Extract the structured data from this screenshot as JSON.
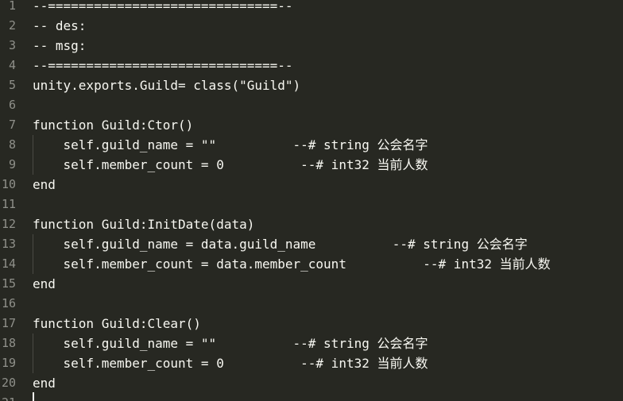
{
  "editor": {
    "lines": [
      {
        "num": "1",
        "text": "--==============================--",
        "indent": 0
      },
      {
        "num": "2",
        "text": "-- des:",
        "indent": 0
      },
      {
        "num": "3",
        "text": "-- msg:",
        "indent": 0
      },
      {
        "num": "4",
        "text": "--==============================--",
        "indent": 0
      },
      {
        "num": "5",
        "text": "unity.exports.Guild= class(\"Guild\")",
        "indent": 0
      },
      {
        "num": "6",
        "text": "",
        "indent": 0
      },
      {
        "num": "7",
        "text": "function Guild:Ctor()",
        "indent": 0
      },
      {
        "num": "8",
        "text": "    self.guild_name = \"\"          --# string 公会名字",
        "indent": 1
      },
      {
        "num": "9",
        "text": "    self.member_count = 0          --# int32 当前人数",
        "indent": 1
      },
      {
        "num": "10",
        "text": "end",
        "indent": 0
      },
      {
        "num": "11",
        "text": "",
        "indent": 0
      },
      {
        "num": "12",
        "text": "function Guild:InitDate(data)",
        "indent": 0
      },
      {
        "num": "13",
        "text": "    self.guild_name = data.guild_name          --# string 公会名字",
        "indent": 1
      },
      {
        "num": "14",
        "text": "    self.member_count = data.member_count          --# int32 当前人数",
        "indent": 1
      },
      {
        "num": "15",
        "text": "end",
        "indent": 0
      },
      {
        "num": "16",
        "text": "",
        "indent": 0
      },
      {
        "num": "17",
        "text": "function Guild:Clear()",
        "indent": 0
      },
      {
        "num": "18",
        "text": "    self.guild_name = \"\"          --# string 公会名字",
        "indent": 1
      },
      {
        "num": "19",
        "text": "    self.member_count = 0          --# int32 当前人数",
        "indent": 1
      },
      {
        "num": "20",
        "text": "end",
        "indent": 0
      },
      {
        "num": "21",
        "text": "",
        "indent": 0
      }
    ]
  },
  "colors": {
    "background": "#272822",
    "foreground": "#f8f8f2",
    "line_number": "#8f908a"
  }
}
